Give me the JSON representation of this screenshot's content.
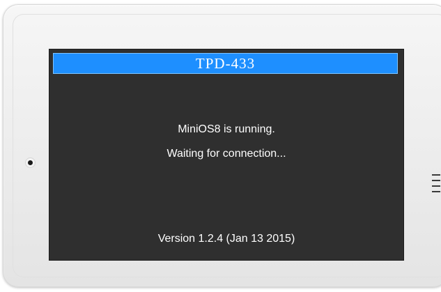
{
  "screen": {
    "title": "TPD-433",
    "messages": [
      "MiniOS8 is running.",
      "Waiting for connection..."
    ],
    "version": "Version 1.2.4 (Jan 13 2015)"
  },
  "colors": {
    "title_bar": "#1e8fff",
    "screen_bg": "#2f2f2f",
    "bezel": "#eeeeee",
    "text": "#ffffff"
  },
  "icons": {
    "left": "camera-dot-icon",
    "right": "speaker-vent-icon"
  }
}
